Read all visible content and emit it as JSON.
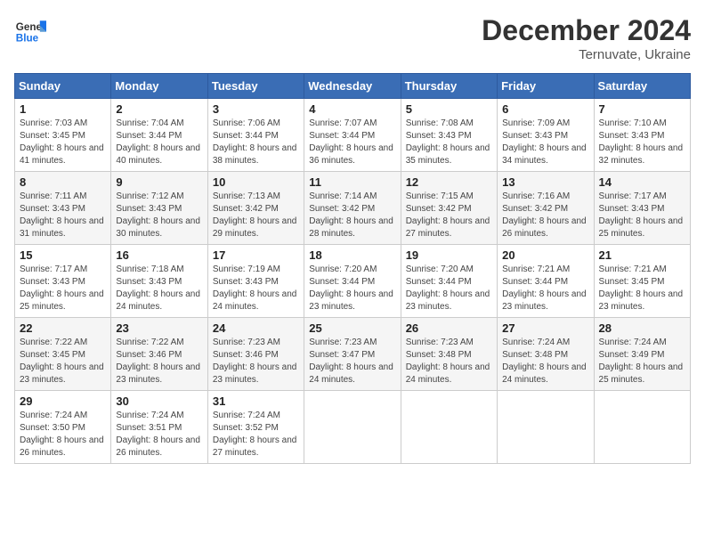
{
  "header": {
    "logo_line1": "General",
    "logo_line2": "Blue",
    "month": "December 2024",
    "location": "Ternuvate, Ukraine"
  },
  "columns": [
    "Sunday",
    "Monday",
    "Tuesday",
    "Wednesday",
    "Thursday",
    "Friday",
    "Saturday"
  ],
  "weeks": [
    [
      {
        "day": "1",
        "sunrise": "Sunrise: 7:03 AM",
        "sunset": "Sunset: 3:45 PM",
        "daylight": "Daylight: 8 hours and 41 minutes."
      },
      {
        "day": "2",
        "sunrise": "Sunrise: 7:04 AM",
        "sunset": "Sunset: 3:44 PM",
        "daylight": "Daylight: 8 hours and 40 minutes."
      },
      {
        "day": "3",
        "sunrise": "Sunrise: 7:06 AM",
        "sunset": "Sunset: 3:44 PM",
        "daylight": "Daylight: 8 hours and 38 minutes."
      },
      {
        "day": "4",
        "sunrise": "Sunrise: 7:07 AM",
        "sunset": "Sunset: 3:44 PM",
        "daylight": "Daylight: 8 hours and 36 minutes."
      },
      {
        "day": "5",
        "sunrise": "Sunrise: 7:08 AM",
        "sunset": "Sunset: 3:43 PM",
        "daylight": "Daylight: 8 hours and 35 minutes."
      },
      {
        "day": "6",
        "sunrise": "Sunrise: 7:09 AM",
        "sunset": "Sunset: 3:43 PM",
        "daylight": "Daylight: 8 hours and 34 minutes."
      },
      {
        "day": "7",
        "sunrise": "Sunrise: 7:10 AM",
        "sunset": "Sunset: 3:43 PM",
        "daylight": "Daylight: 8 hours and 32 minutes."
      }
    ],
    [
      {
        "day": "8",
        "sunrise": "Sunrise: 7:11 AM",
        "sunset": "Sunset: 3:43 PM",
        "daylight": "Daylight: 8 hours and 31 minutes."
      },
      {
        "day": "9",
        "sunrise": "Sunrise: 7:12 AM",
        "sunset": "Sunset: 3:43 PM",
        "daylight": "Daylight: 8 hours and 30 minutes."
      },
      {
        "day": "10",
        "sunrise": "Sunrise: 7:13 AM",
        "sunset": "Sunset: 3:42 PM",
        "daylight": "Daylight: 8 hours and 29 minutes."
      },
      {
        "day": "11",
        "sunrise": "Sunrise: 7:14 AM",
        "sunset": "Sunset: 3:42 PM",
        "daylight": "Daylight: 8 hours and 28 minutes."
      },
      {
        "day": "12",
        "sunrise": "Sunrise: 7:15 AM",
        "sunset": "Sunset: 3:42 PM",
        "daylight": "Daylight: 8 hours and 27 minutes."
      },
      {
        "day": "13",
        "sunrise": "Sunrise: 7:16 AM",
        "sunset": "Sunset: 3:42 PM",
        "daylight": "Daylight: 8 hours and 26 minutes."
      },
      {
        "day": "14",
        "sunrise": "Sunrise: 7:17 AM",
        "sunset": "Sunset: 3:43 PM",
        "daylight": "Daylight: 8 hours and 25 minutes."
      }
    ],
    [
      {
        "day": "15",
        "sunrise": "Sunrise: 7:17 AM",
        "sunset": "Sunset: 3:43 PM",
        "daylight": "Daylight: 8 hours and 25 minutes."
      },
      {
        "day": "16",
        "sunrise": "Sunrise: 7:18 AM",
        "sunset": "Sunset: 3:43 PM",
        "daylight": "Daylight: 8 hours and 24 minutes."
      },
      {
        "day": "17",
        "sunrise": "Sunrise: 7:19 AM",
        "sunset": "Sunset: 3:43 PM",
        "daylight": "Daylight: 8 hours and 24 minutes."
      },
      {
        "day": "18",
        "sunrise": "Sunrise: 7:20 AM",
        "sunset": "Sunset: 3:44 PM",
        "daylight": "Daylight: 8 hours and 23 minutes."
      },
      {
        "day": "19",
        "sunrise": "Sunrise: 7:20 AM",
        "sunset": "Sunset: 3:44 PM",
        "daylight": "Daylight: 8 hours and 23 minutes."
      },
      {
        "day": "20",
        "sunrise": "Sunrise: 7:21 AM",
        "sunset": "Sunset: 3:44 PM",
        "daylight": "Daylight: 8 hours and 23 minutes."
      },
      {
        "day": "21",
        "sunrise": "Sunrise: 7:21 AM",
        "sunset": "Sunset: 3:45 PM",
        "daylight": "Daylight: 8 hours and 23 minutes."
      }
    ],
    [
      {
        "day": "22",
        "sunrise": "Sunrise: 7:22 AM",
        "sunset": "Sunset: 3:45 PM",
        "daylight": "Daylight: 8 hours and 23 minutes."
      },
      {
        "day": "23",
        "sunrise": "Sunrise: 7:22 AM",
        "sunset": "Sunset: 3:46 PM",
        "daylight": "Daylight: 8 hours and 23 minutes."
      },
      {
        "day": "24",
        "sunrise": "Sunrise: 7:23 AM",
        "sunset": "Sunset: 3:46 PM",
        "daylight": "Daylight: 8 hours and 23 minutes."
      },
      {
        "day": "25",
        "sunrise": "Sunrise: 7:23 AM",
        "sunset": "Sunset: 3:47 PM",
        "daylight": "Daylight: 8 hours and 24 minutes."
      },
      {
        "day": "26",
        "sunrise": "Sunrise: 7:23 AM",
        "sunset": "Sunset: 3:48 PM",
        "daylight": "Daylight: 8 hours and 24 minutes."
      },
      {
        "day": "27",
        "sunrise": "Sunrise: 7:24 AM",
        "sunset": "Sunset: 3:48 PM",
        "daylight": "Daylight: 8 hours and 24 minutes."
      },
      {
        "day": "28",
        "sunrise": "Sunrise: 7:24 AM",
        "sunset": "Sunset: 3:49 PM",
        "daylight": "Daylight: 8 hours and 25 minutes."
      }
    ],
    [
      {
        "day": "29",
        "sunrise": "Sunrise: 7:24 AM",
        "sunset": "Sunset: 3:50 PM",
        "daylight": "Daylight: 8 hours and 26 minutes."
      },
      {
        "day": "30",
        "sunrise": "Sunrise: 7:24 AM",
        "sunset": "Sunset: 3:51 PM",
        "daylight": "Daylight: 8 hours and 26 minutes."
      },
      {
        "day": "31",
        "sunrise": "Sunrise: 7:24 AM",
        "sunset": "Sunset: 3:52 PM",
        "daylight": "Daylight: 8 hours and 27 minutes."
      },
      null,
      null,
      null,
      null
    ]
  ]
}
